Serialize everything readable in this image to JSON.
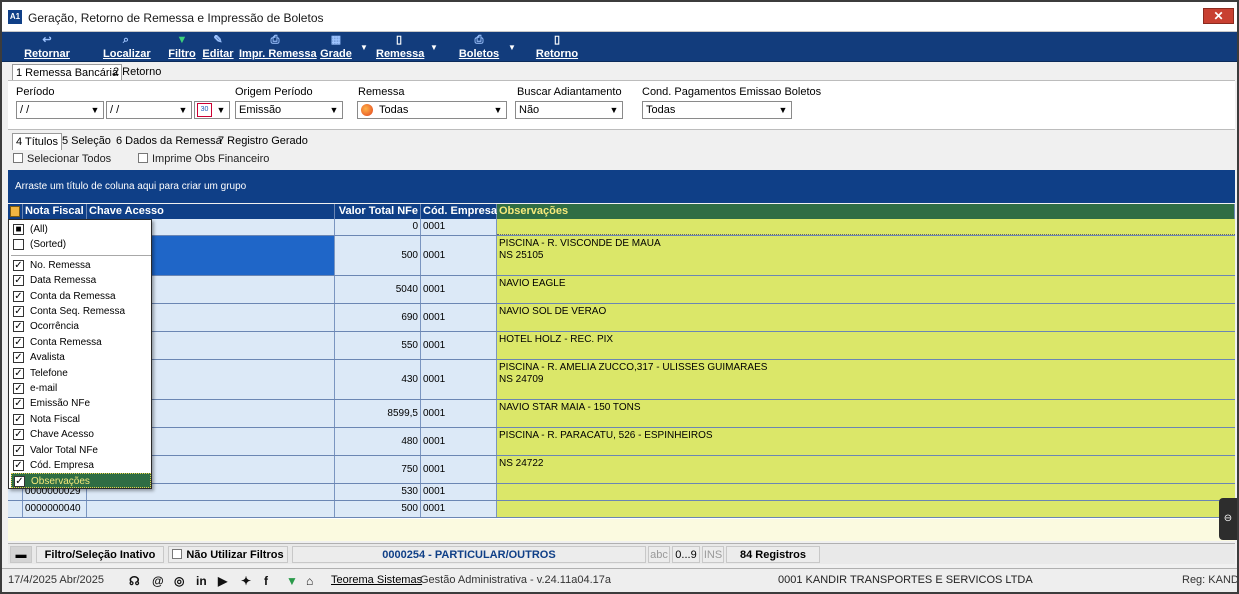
{
  "window": {
    "title": "Geração, Retorno de Remessa e Impressão de Boletos",
    "close": "✕"
  },
  "toolbar": [
    {
      "label": "Retornar",
      "icon": "return-arrow-icon",
      "glyph": "↩"
    },
    {
      "label": "Localizar",
      "icon": "search-icon",
      "glyph": "⌕"
    },
    {
      "label": "Filtro",
      "icon": "filter-icon",
      "glyph": "▼"
    },
    {
      "label": "Editar",
      "icon": "edit-icon",
      "glyph": "✎"
    },
    {
      "label": "Impr. Remessa",
      "icon": "printer-icon",
      "glyph": "⎙"
    },
    {
      "label": "Grade",
      "icon": "grid-icon",
      "glyph": "▦"
    },
    {
      "label": "Remessa",
      "icon": "document-icon",
      "glyph": "▯"
    },
    {
      "label": "Boletos",
      "icon": "printer-icon",
      "glyph": "⎙"
    },
    {
      "label": "Retorno",
      "icon": "document-icon",
      "glyph": "▯"
    }
  ],
  "top_tabs": [
    "1 Remessa Bancária",
    "2 Retorno"
  ],
  "filters": {
    "periodo_label": "Período",
    "date_from": "/ /",
    "date_to": "/ /",
    "origem_label": "Origem Período",
    "origem_value": "Emissão",
    "remessa_label": "Remessa",
    "remessa_value": "Todas",
    "adiant_label": "Buscar Adiantamento",
    "adiant_value": "Não",
    "cond_label": "Cond. Pagamentos Emissao Boletos",
    "cond_value": "Todas"
  },
  "inner_tabs": [
    "4 Títulos",
    "5 Seleção",
    "6 Dados da Remessa",
    "7 Registro Gerado"
  ],
  "options": {
    "select_all": "Selecionar Todos",
    "print_obs": "Imprime Obs Financeiro"
  },
  "group_hint": "Arraste um título de coluna aqui para criar um grupo",
  "columns": {
    "nf": "Nota Fiscal",
    "chave": "Chave Acesso",
    "valor": "Valor Total NFe",
    "empresa": "Cód. Empresa",
    "obs": "Observações"
  },
  "rows": [
    {
      "nf": "",
      "valor": "0",
      "empresa": "0001",
      "obs": ""
    },
    {
      "nf": "",
      "valor": "500",
      "empresa": "0001",
      "obs": "PISCINA - R. VISCONDE DE MAUA\nNS 25105"
    },
    {
      "nf": "",
      "valor": "5040",
      "empresa": "0001",
      "obs": "NAVIO EAGLE"
    },
    {
      "nf": "",
      "valor": "690",
      "empresa": "0001",
      "obs": "NAVIO SOL DE VERAO"
    },
    {
      "nf": "",
      "valor": "550",
      "empresa": "0001",
      "obs": "HOTEL HOLZ - REC. PIX"
    },
    {
      "nf": "",
      "valor": "430",
      "empresa": "0001",
      "obs": "PISCINA - R. AMELIA ZUCCO,317 - ULISSES GUIMARAES\nNS 24709"
    },
    {
      "nf": "",
      "valor": "8599,5",
      "empresa": "0001",
      "obs": "NAVIO STAR MAIA - 150 TONS"
    },
    {
      "nf": "",
      "valor": "480",
      "empresa": "0001",
      "obs": "PISCINA - R. PARACATU, 526 - ESPINHEIROS"
    },
    {
      "nf": "",
      "valor": "750",
      "empresa": "0001",
      "obs": "NS 24722"
    },
    {
      "nf": "0000000029",
      "valor": "530",
      "empresa": "0001",
      "obs": ""
    },
    {
      "nf": "0000000040",
      "valor": "500",
      "empresa": "0001",
      "obs": ""
    }
  ],
  "column_popup": [
    {
      "label": "(All)",
      "state": "partial"
    },
    {
      "label": "(Sorted)",
      "state": "off"
    },
    {
      "label": "No. Remessa",
      "state": "on"
    },
    {
      "label": "Data Remessa",
      "state": "on"
    },
    {
      "label": "Conta da Remessa",
      "state": "on"
    },
    {
      "label": "Conta Seq. Remessa",
      "state": "on"
    },
    {
      "label": "Ocorrência",
      "state": "on"
    },
    {
      "label": "Conta Remessa",
      "state": "on"
    },
    {
      "label": "Avalista",
      "state": "on"
    },
    {
      "label": "Telefone",
      "state": "on"
    },
    {
      "label": "e-mail",
      "state": "on"
    },
    {
      "label": "Emissão NFe",
      "state": "on"
    },
    {
      "label": "Nota Fiscal",
      "state": "on"
    },
    {
      "label": "Chave Acesso",
      "state": "on"
    },
    {
      "label": "Valor Total NFe",
      "state": "on"
    },
    {
      "label": "Cód. Empresa",
      "state": "on"
    },
    {
      "label": "Observações",
      "state": "on"
    }
  ],
  "status": {
    "filtro": "Filtro/Seleção Inativo",
    "nao_filtros": "Não Utilizar Filtros",
    "cliente": "0000254 - PARTICULAR/OUTROS",
    "abc": "abc",
    "digits": "0...9",
    "ins": "INS",
    "registros": "84 Registros"
  },
  "footer": {
    "date": "17/4/2025 Abr/2025",
    "company_link": "Teorema Sistemas",
    "version": "Gestão Administrativa - v.24.11a04.17a",
    "empresa": "0001 KANDIR TRANSPORTES E SERVICOS LTDA",
    "reg": "Reg: KANDI"
  },
  "colors": {
    "navy": "#0f3f87",
    "obs_bg": "#dbe769",
    "obs_header": "#2f6d44",
    "selected_row": "#1f66c8"
  }
}
